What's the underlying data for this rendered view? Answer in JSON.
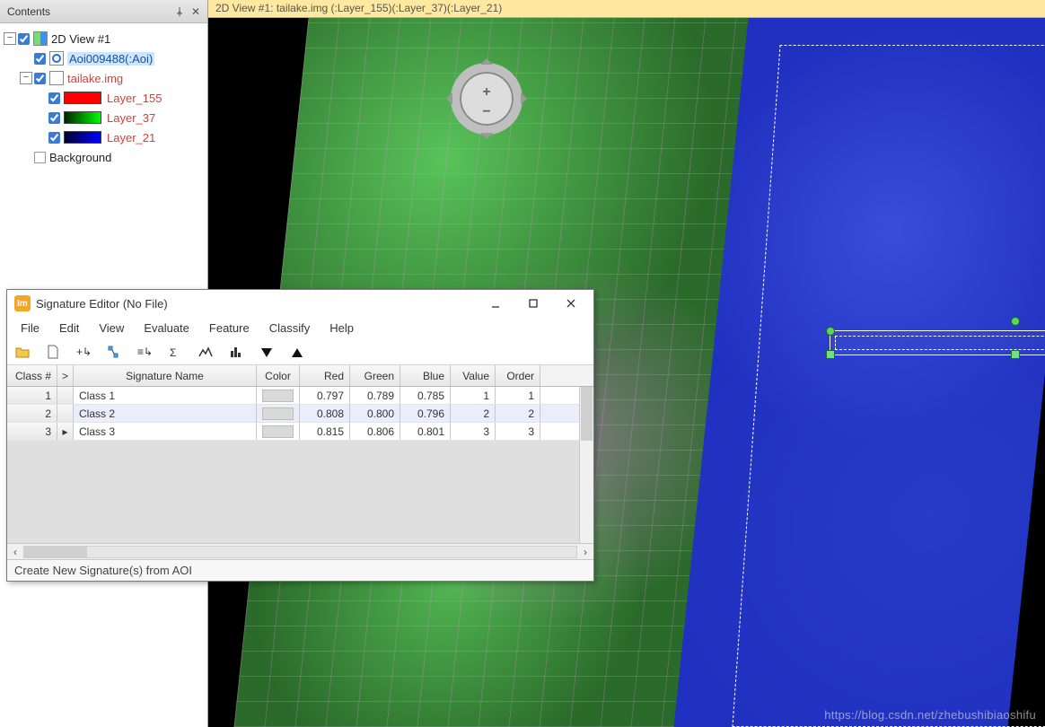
{
  "contents": {
    "title": "Contents",
    "root": {
      "label": "2D View #1"
    },
    "aoi": {
      "label": "Aoi009488(:Aoi)"
    },
    "img": {
      "label": "tailake.img"
    },
    "layers": [
      {
        "label": "Layer_155",
        "color": "#ff0000"
      },
      {
        "label": "Layer_37",
        "color": "#00ff00"
      },
      {
        "label": "Layer_21",
        "color": "#0000ff"
      }
    ],
    "background": {
      "label": "Background"
    }
  },
  "view": {
    "title": "2D View #1: tailake.img (:Layer_155)(:Layer_37)(:Layer_21)"
  },
  "sig_editor": {
    "title": "Signature Editor (No File)",
    "menus": [
      "File",
      "Edit",
      "View",
      "Evaluate",
      "Feature",
      "Classify",
      "Help"
    ],
    "columns": {
      "num": "Class #",
      "arrow": ">",
      "name": "Signature Name",
      "color": "Color",
      "r": "Red",
      "g": "Green",
      "b": "Blue",
      "val": "Value",
      "ord": "Order"
    },
    "rows": [
      {
        "num": "1",
        "arrow": "",
        "name": "Class 1",
        "r": "0.797",
        "g": "0.789",
        "b": "0.785",
        "val": "1",
        "ord": "1"
      },
      {
        "num": "2",
        "arrow": "",
        "name": "Class 2",
        "r": "0.808",
        "g": "0.800",
        "b": "0.796",
        "val": "2",
        "ord": "2"
      },
      {
        "num": "3",
        "arrow": "▸",
        "name": "Class 3",
        "r": "0.815",
        "g": "0.806",
        "b": "0.801",
        "val": "3",
        "ord": "3"
      }
    ],
    "status": "Create New Signature(s) from AOI"
  },
  "watermark": "https://blog.csdn.net/zhebushibiaoshifu"
}
